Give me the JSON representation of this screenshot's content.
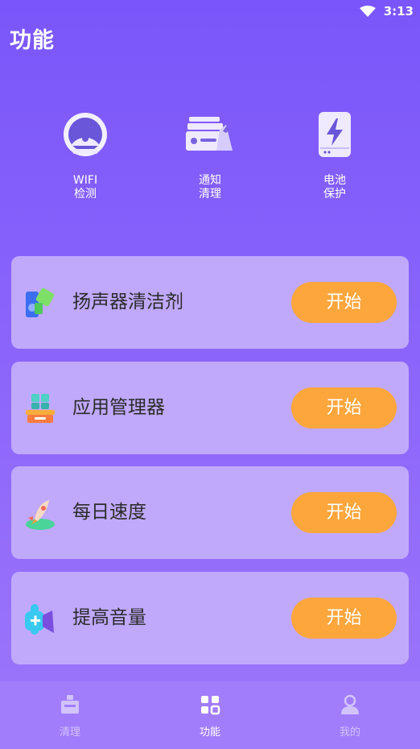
{
  "status": {
    "time": "3:13"
  },
  "page": {
    "title": "功能"
  },
  "quick_tools": [
    {
      "label": "WIFI\n检测",
      "icon": "speedometer-icon"
    },
    {
      "label": "通知\n清理",
      "icon": "notification-clean-icon"
    },
    {
      "label": "电池\n保护",
      "icon": "battery-icon"
    }
  ],
  "features": [
    {
      "title": "扬声器清洁剂",
      "button": "开始",
      "icon": "speaker-cleaner-icon"
    },
    {
      "title": "应用管理器",
      "button": "开始",
      "icon": "app-manager-icon"
    },
    {
      "title": "每日速度",
      "button": "开始",
      "icon": "rocket-icon"
    },
    {
      "title": "提高音量",
      "button": "开始",
      "icon": "volume-boost-icon"
    }
  ],
  "nav": [
    {
      "label": "清理",
      "icon": "clean-icon",
      "active": false
    },
    {
      "label": "功能",
      "icon": "grid-icon",
      "active": true
    },
    {
      "label": "我的",
      "icon": "profile-icon",
      "active": false
    }
  ],
  "colors": {
    "card": "#c0a9fb",
    "button": "#fca63c",
    "nav_bg": "#a17dfb"
  }
}
